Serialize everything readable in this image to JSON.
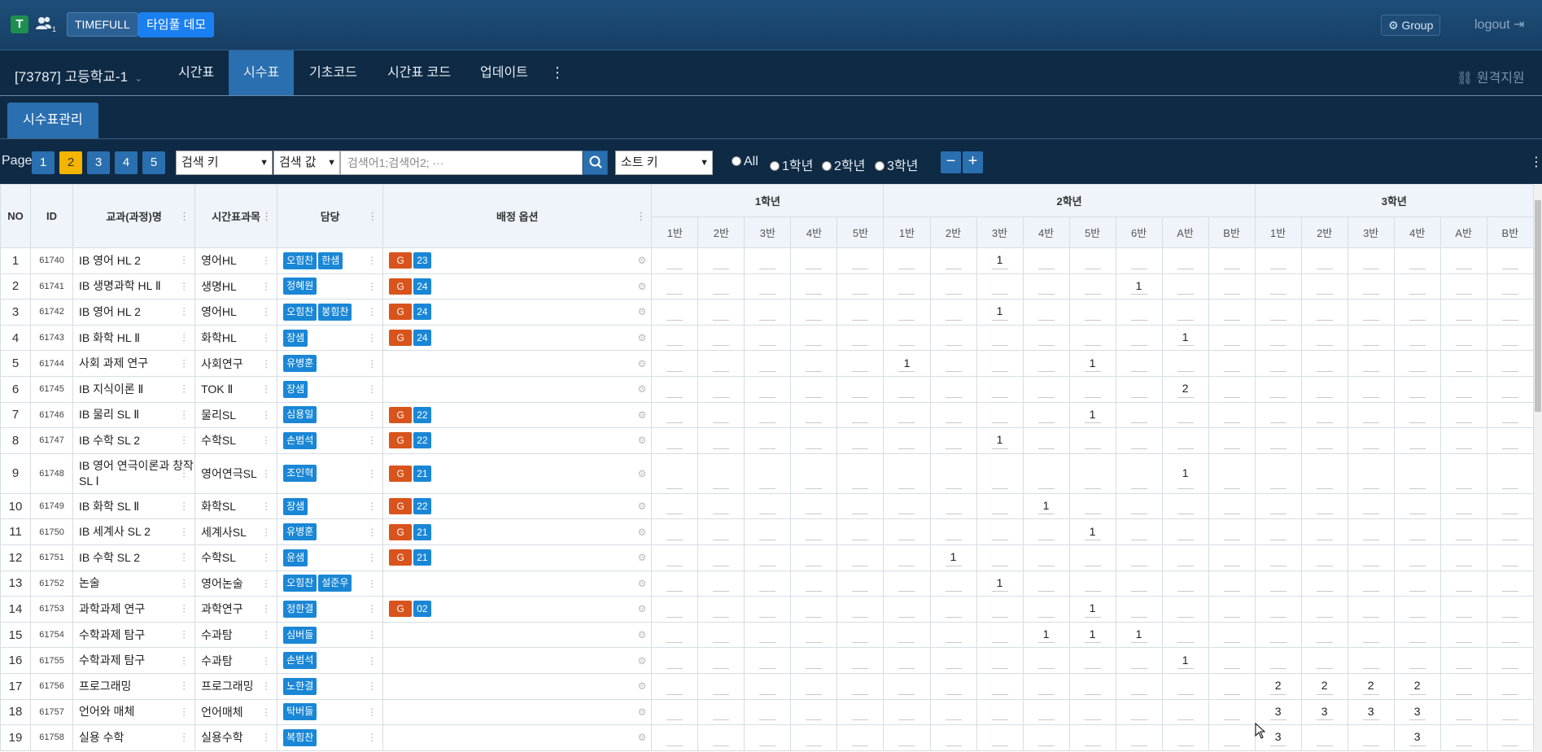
{
  "topbar": {
    "brand_letter": "T",
    "users_count": "1",
    "timefull_label": "TIMEFULL",
    "demo_label": "타임풀 데모",
    "group_label": "Group",
    "logout_label": "logout"
  },
  "navbar": {
    "school": "[73787] 고등학교-1",
    "items": [
      "시간표",
      "시수표",
      "기초코드",
      "시간표 코드",
      "업데이트"
    ],
    "active": "시수표",
    "remote_label": "원격지원"
  },
  "subtab": {
    "label": "시수표관리"
  },
  "toolbar": {
    "page_label": "Page",
    "pages": [
      "1",
      "2",
      "3",
      "4",
      "5"
    ],
    "active_page": "2",
    "search_key": "검색 키",
    "search_value": "검색 값",
    "search_placeholder": "검색어1;검색어2; ···",
    "sort_key": "소트 키",
    "radios": [
      "All",
      "1학년",
      "2학년",
      "3학년"
    ],
    "minus": "−",
    "plus": "+"
  },
  "table": {
    "headers": {
      "no": "NO",
      "id": "ID",
      "subject": "교과(과정)명",
      "tt_subject": "시간표과목",
      "teacher": "담당",
      "assign": "배정 옵션"
    },
    "grades": [
      {
        "label": "1학년",
        "classes": [
          "1반",
          "2반",
          "3반",
          "4반",
          "5반"
        ]
      },
      {
        "label": "2학년",
        "classes": [
          "1반",
          "2반",
          "3반",
          "4반",
          "5반",
          "6반",
          "A반",
          "B반"
        ]
      },
      {
        "label": "3학년",
        "classes": [
          "1반",
          "2반",
          "3반",
          "4반",
          "A반",
          "B반"
        ]
      }
    ],
    "rows": [
      {
        "no": "1",
        "id": "61740",
        "subject": "IB 영어 HL 2",
        "tt": "영어HL",
        "teachers": [
          "오힘찬",
          "한샘"
        ],
        "g": "G",
        "gnum": "23",
        "cells": [
          "",
          "",
          "",
          "",
          "",
          "",
          "",
          "1",
          "",
          "",
          "",
          "",
          "",
          "",
          "",
          "",
          "",
          "",
          ""
        ]
      },
      {
        "no": "2",
        "id": "61741",
        "subject": "IB 생명과학 HL Ⅱ",
        "tt": "생명HL",
        "teachers": [
          "정혜원"
        ],
        "g": "G",
        "gnum": "24",
        "cells": [
          "",
          "",
          "",
          "",
          "",
          "",
          "",
          "",
          "",
          "",
          "1",
          "",
          "",
          "",
          "",
          "",
          "",
          "",
          ""
        ]
      },
      {
        "no": "3",
        "id": "61742",
        "subject": "IB 영어 HL 2",
        "tt": "영어HL",
        "teachers": [
          "오힘찬",
          "봉힘찬"
        ],
        "g": "G",
        "gnum": "24",
        "cells": [
          "",
          "",
          "",
          "",
          "",
          "",
          "",
          "1",
          "",
          "",
          "",
          "",
          "",
          "",
          "",
          "",
          "",
          "",
          ""
        ]
      },
      {
        "no": "4",
        "id": "61743",
        "subject": "IB 화학 HL Ⅱ",
        "tt": "화학HL",
        "teachers": [
          "장샘"
        ],
        "g": "G",
        "gnum": "24",
        "cells": [
          "",
          "",
          "",
          "",
          "",
          "",
          "",
          "",
          "",
          "",
          "",
          "1",
          "",
          "",
          "",
          "",
          "",
          "",
          ""
        ]
      },
      {
        "no": "5",
        "id": "61744",
        "subject": "사회 과제 연구",
        "tt": "사회연구",
        "teachers": [
          "유병훈"
        ],
        "g": "",
        "gnum": "",
        "cells": [
          "",
          "",
          "",
          "",
          "",
          "1",
          "",
          "",
          "",
          "1",
          "",
          "",
          "",
          "",
          "",
          "",
          "",
          "",
          ""
        ]
      },
      {
        "no": "6",
        "id": "61745",
        "subject": "IB 지식이론 Ⅱ",
        "tt": "TOK Ⅱ",
        "teachers": [
          "장샘"
        ],
        "g": "",
        "gnum": "",
        "cells": [
          "",
          "",
          "",
          "",
          "",
          "",
          "",
          "",
          "",
          "",
          "",
          "2",
          "",
          "",
          "",
          "",
          "",
          "",
          ""
        ]
      },
      {
        "no": "7",
        "id": "61746",
        "subject": "IB 물리 SL Ⅱ",
        "tt": "물리SL",
        "teachers": [
          "심용일"
        ],
        "g": "G",
        "gnum": "22",
        "cells": [
          "",
          "",
          "",
          "",
          "",
          "",
          "",
          "",
          "",
          "1",
          "",
          "",
          "",
          "",
          "",
          "",
          "",
          "",
          ""
        ]
      },
      {
        "no": "8",
        "id": "61747",
        "subject": "IB 수학 SL 2",
        "tt": "수학SL",
        "teachers": [
          "손범석"
        ],
        "g": "G",
        "gnum": "22",
        "cells": [
          "",
          "",
          "",
          "",
          "",
          "",
          "",
          "1",
          "",
          "",
          "",
          "",
          "",
          "",
          "",
          "",
          "",
          "",
          ""
        ]
      },
      {
        "no": "9",
        "id": "61748",
        "subject": "IB 영어 연극이론과 창작 SL Ⅰ",
        "tt": "영어연극SL",
        "teachers": [
          "조인혁"
        ],
        "g": "G",
        "gnum": "21",
        "cells": [
          "",
          "",
          "",
          "",
          "",
          "",
          "",
          "",
          "",
          "",
          "",
          "1",
          "",
          "",
          "",
          "",
          "",
          "",
          ""
        ]
      },
      {
        "no": "10",
        "id": "61749",
        "subject": "IB 화학 SL Ⅱ",
        "tt": "화학SL",
        "teachers": [
          "장샘"
        ],
        "g": "G",
        "gnum": "22",
        "cells": [
          "",
          "",
          "",
          "",
          "",
          "",
          "",
          "",
          "1",
          "",
          "",
          "",
          "",
          "",
          "",
          "",
          "",
          "",
          ""
        ]
      },
      {
        "no": "11",
        "id": "61750",
        "subject": "IB 세계사 SL 2",
        "tt": "세계사SL",
        "teachers": [
          "유병훈"
        ],
        "g": "G",
        "gnum": "21",
        "cells": [
          "",
          "",
          "",
          "",
          "",
          "",
          "",
          "",
          "",
          "1",
          "",
          "",
          "",
          "",
          "",
          "",
          "",
          "",
          ""
        ]
      },
      {
        "no": "12",
        "id": "61751",
        "subject": "IB 수학 SL 2",
        "tt": "수학SL",
        "teachers": [
          "윤샘"
        ],
        "g": "G",
        "gnum": "21",
        "cells": [
          "",
          "",
          "",
          "",
          "",
          "",
          "1",
          "",
          "",
          "",
          "",
          "",
          "",
          "",
          "",
          "",
          "",
          "",
          ""
        ]
      },
      {
        "no": "13",
        "id": "61752",
        "subject": "논술",
        "tt": "영어논술",
        "teachers": [
          "오힘찬",
          "설준우"
        ],
        "g": "",
        "gnum": "",
        "cells": [
          "",
          "",
          "",
          "",
          "",
          "",
          "",
          "1",
          "",
          "",
          "",
          "",
          "",
          "",
          "",
          "",
          "",
          "",
          ""
        ]
      },
      {
        "no": "14",
        "id": "61753",
        "subject": "과학과제 연구",
        "tt": "과학연구",
        "teachers": [
          "정한결"
        ],
        "g": "G",
        "gnum": "02",
        "cells": [
          "",
          "",
          "",
          "",
          "",
          "",
          "",
          "",
          "",
          "1",
          "",
          "",
          "",
          "",
          "",
          "",
          "",
          "",
          ""
        ]
      },
      {
        "no": "15",
        "id": "61754",
        "subject": "수학과제 탐구",
        "tt": "수과탐",
        "teachers": [
          "심버들"
        ],
        "g": "",
        "gnum": "",
        "cells": [
          "",
          "",
          "",
          "",
          "",
          "",
          "",
          "",
          "1",
          "1",
          "1",
          "",
          "",
          "",
          "",
          "",
          "",
          "",
          ""
        ]
      },
      {
        "no": "16",
        "id": "61755",
        "subject": "수학과제 탐구",
        "tt": "수과탐",
        "teachers": [
          "손범석"
        ],
        "g": "",
        "gnum": "",
        "cells": [
          "",
          "",
          "",
          "",
          "",
          "",
          "",
          "",
          "",
          "",
          "",
          "1",
          "",
          "",
          "",
          "",
          "",
          "",
          ""
        ]
      },
      {
        "no": "17",
        "id": "61756",
        "subject": "프로그래밍",
        "tt": "프로그래밍",
        "teachers": [
          "노한결"
        ],
        "g": "",
        "gnum": "",
        "cells": [
          "",
          "",
          "",
          "",
          "",
          "",
          "",
          "",
          "",
          "",
          "",
          "",
          "",
          "2",
          "2",
          "2",
          "2",
          "",
          ""
        ]
      },
      {
        "no": "18",
        "id": "61757",
        "subject": "언어와 매체",
        "tt": "언어매체",
        "teachers": [
          "탁버들"
        ],
        "g": "",
        "gnum": "",
        "cells": [
          "",
          "",
          "",
          "",
          "",
          "",
          "",
          "",
          "",
          "",
          "",
          "",
          "",
          "3",
          "3",
          "3",
          "3",
          "",
          ""
        ]
      },
      {
        "no": "19",
        "id": "61758",
        "subject": "실용 수학",
        "tt": "실용수학",
        "teachers": [
          "복힘찬"
        ],
        "g": "",
        "gnum": "",
        "cells": [
          "",
          "",
          "",
          "",
          "",
          "",
          "",
          "",
          "",
          "",
          "",
          "",
          "",
          "3",
          "",
          "",
          "3",
          "",
          ""
        ]
      }
    ]
  },
  "colors": {
    "header_bg": "#1d4e7a",
    "nav_bg": "#0f2a45",
    "accent": "#2a6fb0",
    "active_page": "#f4b400",
    "teacher_badge": "#1a87d6",
    "g_badge": "#d8541c"
  }
}
